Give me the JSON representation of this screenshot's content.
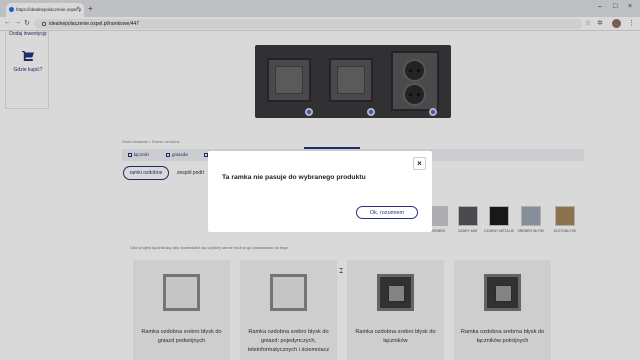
{
  "browser": {
    "tab_title": "https://idealnepolaczenie.ospel.p",
    "tab_close": "×",
    "new_tab": "+",
    "url": "idealnepolaczenie.ospel.pl/ramkowe/447",
    "window_controls": {
      "minimize": "–",
      "maximize": "□",
      "close": "×"
    }
  },
  "sidebar": {
    "top_label": "Dodaj inwestycję",
    "shop_label": "Gdzie kupić?"
  },
  "breadcrumb": "Seria ideałowe • Ramki ozdobne",
  "filters": {
    "chips": [
      "łączniki",
      "gniazda",
      "ramki"
    ]
  },
  "pills": {
    "active": "ramki ozdobne",
    "next": "zespół podtr"
  },
  "colors": [
    {
      "label": "SREBRO",
      "hex": "#c9ccd1"
    },
    {
      "label": "SZARY MAT",
      "hex": "#55575b"
    },
    {
      "label": "CZARNY METALIK",
      "hex": "#1d1d1f"
    },
    {
      "label": "SREBRO BŁYSK",
      "hex": "#9fa7b5"
    },
    {
      "label": "ZŁOTOBŁYSK",
      "hex": "#a6845a"
    }
  ],
  "note": "Ułóż projekt łącznikowy aby dowiedzieć się w jakiej ramce można go zastosować do tego",
  "cards": [
    {
      "title": "Ramka ozdobna srebro błysk do gniazd podwójnych"
    },
    {
      "title": "Ramka ozdobna srebro błysk do gniazd: pojedynczych, teleinformatycznych i ściemniacz"
    },
    {
      "title": "Ramka ozdobna srebro błysk do łączników"
    },
    {
      "title": "Ramka ozdobna srebrna błysk do łączników potrójnych"
    }
  ],
  "modal": {
    "title": "Ta ramka nie pasuje do wybranego produktu",
    "close": "×",
    "button": "Ok, rozumiem"
  },
  "theme": {
    "accent": "#26337a"
  }
}
